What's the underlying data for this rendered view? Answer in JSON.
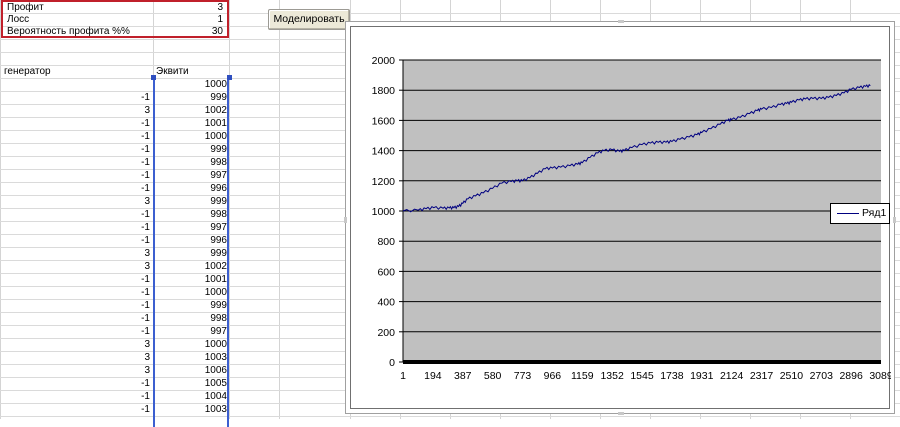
{
  "parameters": [
    {
      "label": "Профит",
      "value": "3"
    },
    {
      "label": "Лосс",
      "value": "1"
    },
    {
      "label": "Вероятность профита %%",
      "value": "30"
    }
  ],
  "simulate_button": "Моделировать",
  "headers": {
    "generator": "генератор",
    "equity": "Эквити"
  },
  "first_equity": "1000",
  "rows": [
    {
      "gen": "-1",
      "eq": "999"
    },
    {
      "gen": "3",
      "eq": "1002"
    },
    {
      "gen": "-1",
      "eq": "1001"
    },
    {
      "gen": "-1",
      "eq": "1000"
    },
    {
      "gen": "-1",
      "eq": "999"
    },
    {
      "gen": "-1",
      "eq": "998"
    },
    {
      "gen": "-1",
      "eq": "997"
    },
    {
      "gen": "-1",
      "eq": "996"
    },
    {
      "gen": "3",
      "eq": "999"
    },
    {
      "gen": "-1",
      "eq": "998"
    },
    {
      "gen": "-1",
      "eq": "997"
    },
    {
      "gen": "-1",
      "eq": "996"
    },
    {
      "gen": "3",
      "eq": "999"
    },
    {
      "gen": "3",
      "eq": "1002"
    },
    {
      "gen": "-1",
      "eq": "1001"
    },
    {
      "gen": "-1",
      "eq": "1000"
    },
    {
      "gen": "-1",
      "eq": "999"
    },
    {
      "gen": "-1",
      "eq": "998"
    },
    {
      "gen": "-1",
      "eq": "997"
    },
    {
      "gen": "3",
      "eq": "1000"
    },
    {
      "gen": "3",
      "eq": "1003"
    },
    {
      "gen": "3",
      "eq": "1006"
    },
    {
      "gen": "-1",
      "eq": "1005"
    },
    {
      "gen": "-1",
      "eq": "1004"
    },
    {
      "gen": "-1",
      "eq": "1003"
    }
  ],
  "colors": {
    "plot_area": "#c0c0c0",
    "series": "#000080",
    "selection": "#3c5fd0",
    "params_border": "#c0202b"
  },
  "chart_data": {
    "type": "line",
    "ylim": [
      0,
      2000
    ],
    "yticks": [
      0,
      200,
      400,
      600,
      800,
      1000,
      1200,
      1400,
      1600,
      1800,
      2000
    ],
    "xlim": [
      1,
      3089
    ],
    "xticks": [
      1,
      194,
      387,
      580,
      773,
      966,
      1159,
      1352,
      1545,
      1738,
      1931,
      2124,
      2317,
      2510,
      2703,
      2896,
      3089
    ],
    "grid": "horizontal",
    "legend_position": "right",
    "series": [
      {
        "name": "Ряд1",
        "points": [
          [
            1,
            1000
          ],
          [
            100,
            1005
          ],
          [
            150,
            1015
          ],
          [
            200,
            1022
          ],
          [
            260,
            1018
          ],
          [
            300,
            1020
          ],
          [
            330,
            1022
          ],
          [
            360,
            1030
          ],
          [
            387,
            1050
          ],
          [
            420,
            1080
          ],
          [
            470,
            1100
          ],
          [
            520,
            1120
          ],
          [
            580,
            1150
          ],
          [
            640,
            1185
          ],
          [
            700,
            1195
          ],
          [
            740,
            1200
          ],
          [
            773,
            1200
          ],
          [
            820,
            1220
          ],
          [
            870,
            1250
          ],
          [
            920,
            1280
          ],
          [
            966,
            1285
          ],
          [
            1020,
            1290
          ],
          [
            1080,
            1300
          ],
          [
            1130,
            1310
          ],
          [
            1159,
            1320
          ],
          [
            1210,
            1355
          ],
          [
            1260,
            1385
          ],
          [
            1300,
            1400
          ],
          [
            1352,
            1405
          ],
          [
            1400,
            1395
          ],
          [
            1430,
            1400
          ],
          [
            1480,
            1420
          ],
          [
            1545,
            1440
          ],
          [
            1600,
            1450
          ],
          [
            1650,
            1455
          ],
          [
            1700,
            1455
          ],
          [
            1738,
            1460
          ],
          [
            1790,
            1475
          ],
          [
            1850,
            1490
          ],
          [
            1900,
            1505
          ],
          [
            1931,
            1520
          ],
          [
            1990,
            1545
          ],
          [
            2050,
            1575
          ],
          [
            2100,
            1600
          ],
          [
            2124,
            1605
          ],
          [
            2180,
            1620
          ],
          [
            2240,
            1645
          ],
          [
            2290,
            1665
          ],
          [
            2317,
            1675
          ],
          [
            2380,
            1685
          ],
          [
            2440,
            1705
          ],
          [
            2480,
            1712
          ],
          [
            2510,
            1720
          ],
          [
            2560,
            1735
          ],
          [
            2600,
            1742
          ],
          [
            2650,
            1745
          ],
          [
            2703,
            1745
          ],
          [
            2750,
            1752
          ],
          [
            2800,
            1765
          ],
          [
            2850,
            1782
          ],
          [
            2896,
            1805
          ],
          [
            2950,
            1818
          ],
          [
            2990,
            1825
          ],
          [
            3020,
            1830
          ]
        ]
      }
    ]
  }
}
